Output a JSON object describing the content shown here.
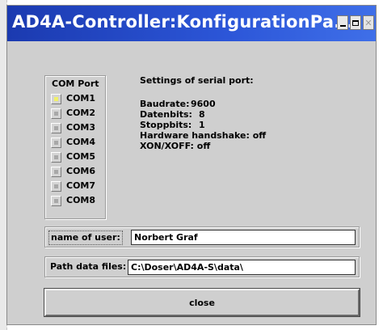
{
  "window": {
    "title": "AD4A-Controller:KonfigurationPa...",
    "accent_color": "#2c56d8"
  },
  "com_port": {
    "title": "COM Port",
    "selected": "COM1",
    "items": [
      {
        "label": "COM1",
        "selected": true
      },
      {
        "label": "COM2",
        "selected": false
      },
      {
        "label": "COM3",
        "selected": false
      },
      {
        "label": "COM4",
        "selected": false
      },
      {
        "label": "COM5",
        "selected": false
      },
      {
        "label": "COM6",
        "selected": false
      },
      {
        "label": "COM7",
        "selected": false
      },
      {
        "label": "COM8",
        "selected": false
      }
    ]
  },
  "settings": {
    "heading": "Settings of serial port:",
    "baudrate_label": "Baudrate:",
    "baudrate_value": "9600",
    "databits_label": "Datenbits:",
    "databits_value": "8",
    "stopbits_label": "Stoppbits:",
    "stopbits_value": "1",
    "handshake": "Hardware handshake: off",
    "xonxoff": "XON/XOFF: off"
  },
  "user": {
    "label": "name of user:",
    "value": "Norbert Graf"
  },
  "path": {
    "label": "Path data files:",
    "value": "C:\\Doser\\AD4A-S\\data\\"
  },
  "buttons": {
    "close_label": "close"
  }
}
